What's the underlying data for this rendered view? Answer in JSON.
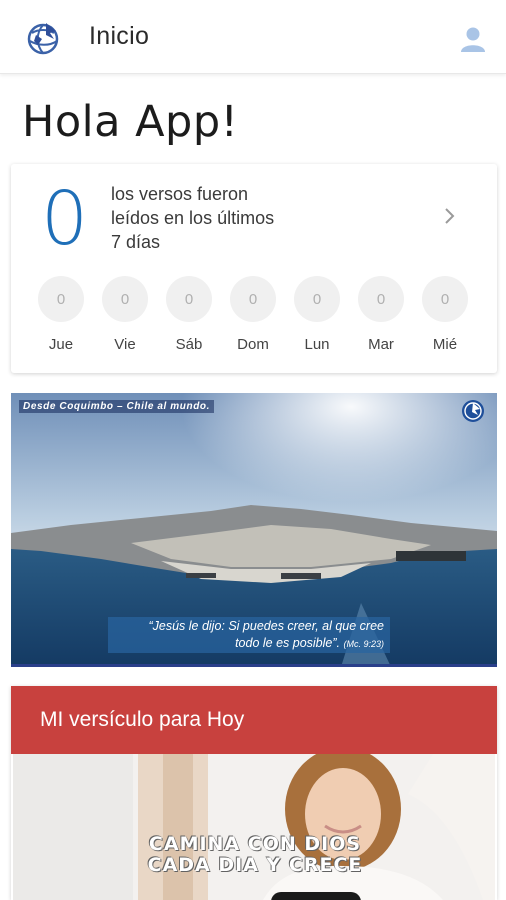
{
  "appbar": {
    "title": "Inicio",
    "logo_icon": "globe-logo-icon",
    "user_icon": "user-account-icon"
  },
  "greeting": "Hola App!",
  "stats": {
    "count": "0",
    "description": "los versos fueron leídos en los últimos 7 días",
    "chevron_icon": "chevron-right-icon",
    "days": [
      {
        "label": "Jue",
        "value": "0"
      },
      {
        "label": "Vie",
        "value": "0"
      },
      {
        "label": "Sáb",
        "value": "0"
      },
      {
        "label": "Dom",
        "value": "0"
      },
      {
        "label": "Lun",
        "value": "0"
      },
      {
        "label": "Mar",
        "value": "0"
      },
      {
        "label": "Mié",
        "value": "0"
      }
    ]
  },
  "banner": {
    "caption": "Desde Coquimbo – Chile al mundo.",
    "quote_line1": "“Jesús le dijo: Si puedes creer, al que cree",
    "quote_line2": "todo le es posible”.",
    "quote_ref": "(Mc. 9:23)"
  },
  "verse_card": {
    "title": "MI versículo para Hoy",
    "image_text_line1": "CAMINA CON DIOS",
    "image_text_line2": "CADA DIA Y CRECE"
  },
  "colors": {
    "accent_blue": "#1f6fb8",
    "header_red": "#c8413e",
    "banner_border": "#2a3f8a"
  }
}
